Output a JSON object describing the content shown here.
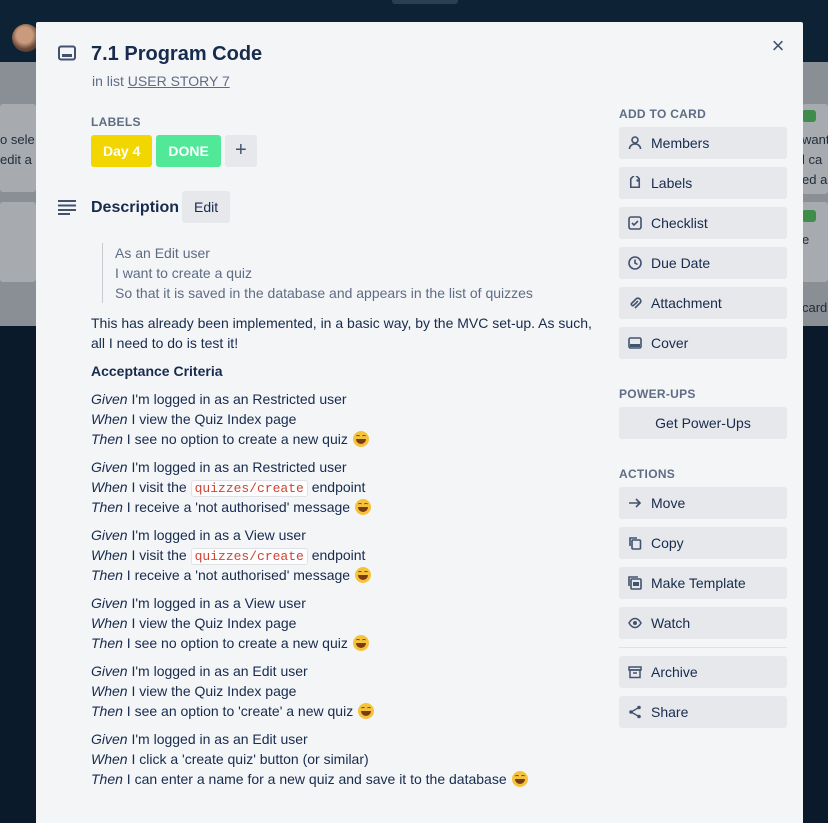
{
  "card": {
    "title": "7.1 Program Code",
    "in_list_prefix": "in list",
    "list_name": "USER STORY 7",
    "close_symbol": "×"
  },
  "labels": {
    "heading": "LABELS",
    "items": [
      {
        "text": "Day 4",
        "color": "#f2d600"
      },
      {
        "text": "DONE",
        "color": "#51e898"
      }
    ],
    "add_symbol": "+"
  },
  "description": {
    "heading": "Description",
    "edit_label": "Edit",
    "quote_lines": [
      "As an Edit user",
      "I want to create a quiz",
      "So that it is saved in the database and appears in the list of quizzes"
    ],
    "intro": "This has already been implemented, in a basic way, by the MVC set-up. As such, all I need to do is test it!",
    "criteria_heading": "Acceptance Criteria",
    "scenarios": [
      [
        {
          "kw": "Given",
          "text": " I'm logged in as an Restricted user"
        },
        {
          "kw": "When",
          "text": " I view the Quiz Index page"
        },
        {
          "kw": "Then",
          "text": " I see no option to create a new quiz",
          "emoji": true
        }
      ],
      [
        {
          "kw": "Given",
          "text": " I'm logged in as an Restricted user"
        },
        {
          "kw": "When",
          "text": " I visit the ",
          "code": "quizzes/create",
          "after": " endpoint"
        },
        {
          "kw": "Then",
          "text": " I receive a 'not authorised' message",
          "emoji": true
        }
      ],
      [
        {
          "kw": "Given",
          "text": " I'm logged in as a View user"
        },
        {
          "kw": "When",
          "text": " I visit the ",
          "code": "quizzes/create",
          "after": " endpoint"
        },
        {
          "kw": "Then",
          "text": " I receive a 'not authorised' message",
          "emoji": true
        }
      ],
      [
        {
          "kw": "Given",
          "text": " I'm logged in as a View user"
        },
        {
          "kw": "When",
          "text": " I view the Quiz Index page"
        },
        {
          "kw": "Then",
          "text": " I see no option to create a new quiz",
          "emoji": true
        }
      ],
      [
        {
          "kw": "Given",
          "text": " I'm logged in as an Edit user"
        },
        {
          "kw": "When",
          "text": " I view the Quiz Index page"
        },
        {
          "kw": "Then",
          "text": " I see an option to 'create' a new quiz",
          "emoji": true
        }
      ],
      [
        {
          "kw": "Given",
          "text": " I'm logged in as an Edit user"
        },
        {
          "kw": "When",
          "text": " I click a 'create quiz' button (or similar)"
        },
        {
          "kw": "Then",
          "text": " I can enter a name for a new quiz and save it to the database",
          "emoji": true
        }
      ]
    ]
  },
  "sidebar": {
    "add_to_card_heading": "ADD TO CARD",
    "add_to_card": [
      {
        "label": "Members",
        "icon": "person-icon"
      },
      {
        "label": "Labels",
        "icon": "tag-icon"
      },
      {
        "label": "Checklist",
        "icon": "checklist-icon"
      },
      {
        "label": "Due Date",
        "icon": "clock-icon"
      },
      {
        "label": "Attachment",
        "icon": "paperclip-icon"
      },
      {
        "label": "Cover",
        "icon": "cover-icon"
      }
    ],
    "powerups_heading": "POWER-UPS",
    "get_powerups": "Get Power-Ups",
    "actions_heading": "ACTIONS",
    "actions": [
      {
        "label": "Move",
        "icon": "arrow-right-icon"
      },
      {
        "label": "Copy",
        "icon": "copy-icon"
      },
      {
        "label": "Make Template",
        "icon": "template-icon"
      },
      {
        "label": "Watch",
        "icon": "eye-icon"
      }
    ],
    "archive_label": "Archive",
    "share_label": "Share"
  },
  "background": {
    "left_snippets": [
      "o sele",
      "edit a"
    ],
    "right_snippets": [
      "want",
      "l ca",
      "ed a",
      "e",
      "card"
    ]
  }
}
